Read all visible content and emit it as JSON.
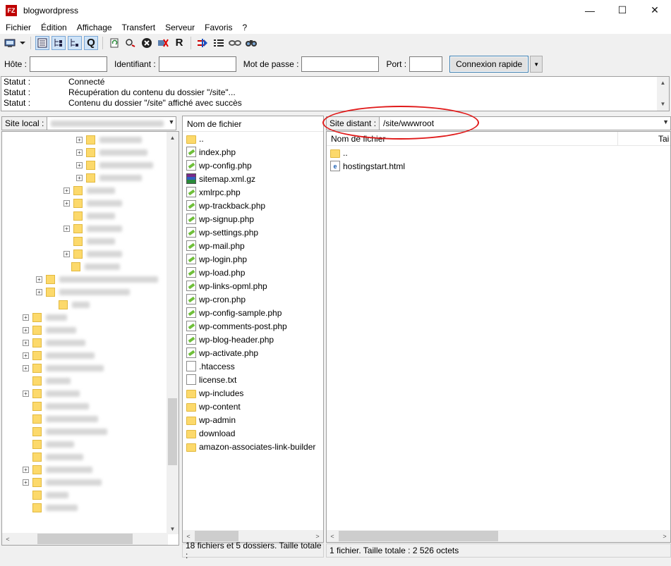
{
  "window": {
    "title": "blogwordpress",
    "app_icon": "FZ",
    "minimize": "—",
    "maximize": "☐",
    "close": "✕"
  },
  "menu": [
    "Fichier",
    "Édition",
    "Affichage",
    "Transfert",
    "Serveur",
    "Favoris",
    "?"
  ],
  "toolbar": {
    "icons": [
      "site-manager-icon",
      "dropdown-arrow-icon",
      "toggle-log-icon",
      "toggle-local-tree-icon",
      "toggle-remote-tree-icon",
      "toggle-queue-icon",
      "refresh-icon",
      "process-queue-icon",
      "cancel-icon",
      "disconnect-icon",
      "reconnect-icon",
      "compare-icon",
      "filter-icon",
      "sync-browse-icon",
      "search-icon"
    ],
    "reconnect_glyph": "R",
    "queue_glyph": "Q"
  },
  "quickconnect": {
    "host_label": "Hôte :",
    "user_label": "Identifiant :",
    "pass_label": "Mot de passe :",
    "port_label": "Port :",
    "host_value": "",
    "user_value": "",
    "pass_value": "",
    "port_value": "",
    "connect_button": "Connexion rapide"
  },
  "log": [
    {
      "key": "Statut :",
      "msg": "Connecté"
    },
    {
      "key": "Statut :",
      "msg": "Récupération du contenu du dossier \"/site\"..."
    },
    {
      "key": "Statut :",
      "msg": "Contenu du dossier \"/site\" affiché avec succès"
    }
  ],
  "local": {
    "site_label": "Site local :",
    "files_header": "Nom de fichier",
    "files": [
      {
        "name": "..",
        "type": "folder"
      },
      {
        "name": "index.php",
        "type": "php"
      },
      {
        "name": "wp-config.php",
        "type": "php"
      },
      {
        "name": "sitemap.xml.gz",
        "type": "gz"
      },
      {
        "name": "xmlrpc.php",
        "type": "php"
      },
      {
        "name": "wp-trackback.php",
        "type": "php"
      },
      {
        "name": "wp-signup.php",
        "type": "php"
      },
      {
        "name": "wp-settings.php",
        "type": "php"
      },
      {
        "name": "wp-mail.php",
        "type": "php"
      },
      {
        "name": "wp-login.php",
        "type": "php"
      },
      {
        "name": "wp-load.php",
        "type": "php"
      },
      {
        "name": "wp-links-opml.php",
        "type": "php"
      },
      {
        "name": "wp-cron.php",
        "type": "php"
      },
      {
        "name": "wp-config-sample.php",
        "type": "php"
      },
      {
        "name": "wp-comments-post.php",
        "type": "php"
      },
      {
        "name": "wp-blog-header.php",
        "type": "php"
      },
      {
        "name": "wp-activate.php",
        "type": "php"
      },
      {
        "name": ".htaccess",
        "type": "txt"
      },
      {
        "name": "license.txt",
        "type": "txt"
      },
      {
        "name": "wp-includes",
        "type": "folder"
      },
      {
        "name": "wp-content",
        "type": "folder"
      },
      {
        "name": "wp-admin",
        "type": "folder"
      },
      {
        "name": "download",
        "type": "folder"
      },
      {
        "name": "amazon-associates-link-builder",
        "type": "folder"
      }
    ],
    "status": "18 fichiers et 5 dossiers. Taille totale :"
  },
  "remote": {
    "site_label": "Site distant :",
    "path": "/site/wwwroot",
    "files_header": "Nom de fichier",
    "size_header": "Tai",
    "files": [
      {
        "name": "..",
        "type": "folder"
      },
      {
        "name": "hostingstart.html",
        "type": "html"
      }
    ],
    "status": "1 fichier. Taille totale : 2 526 octets"
  },
  "colors": {
    "annotation": "#e01a1a",
    "folder": "#fcd96b",
    "accent": "#3c7fb1"
  }
}
